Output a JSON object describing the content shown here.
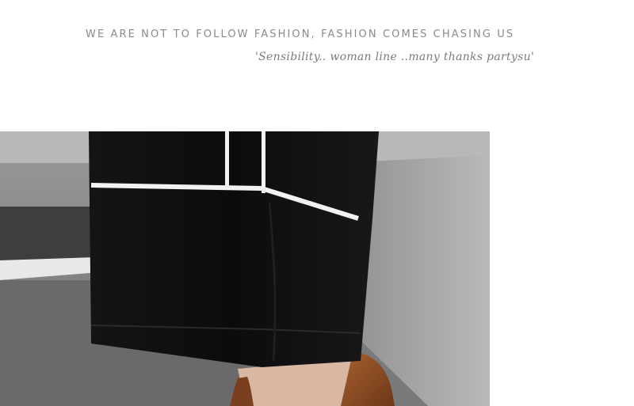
{
  "header": {
    "tagline": "WE ARE NOT TO FOLLOW FASHION, FASHION COMES CHASING US",
    "script_line": "'Sensibility.. woman line ..many thanks partysu'"
  },
  "photo": {
    "subject": "black wide-leg trouser hem with white piping over brown shoe",
    "colors": {
      "fabric": "#0e0e10",
      "piping": "#f2f2f2",
      "pavement": "#5e5e60",
      "step": "#a9a9ab",
      "shoe": "#8a4a26",
      "skin": "#d9b8a3"
    }
  }
}
